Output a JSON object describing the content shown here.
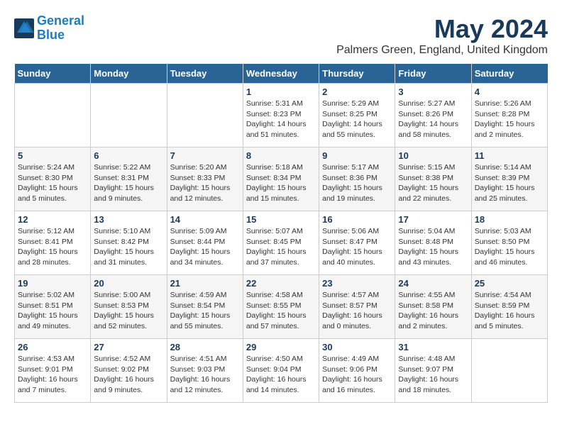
{
  "header": {
    "logo_line1": "General",
    "logo_line2": "Blue",
    "month": "May 2024",
    "location": "Palmers Green, England, United Kingdom"
  },
  "days_of_week": [
    "Sunday",
    "Monday",
    "Tuesday",
    "Wednesday",
    "Thursday",
    "Friday",
    "Saturday"
  ],
  "weeks": [
    [
      {
        "day": "",
        "info": ""
      },
      {
        "day": "",
        "info": ""
      },
      {
        "day": "",
        "info": ""
      },
      {
        "day": "1",
        "info": "Sunrise: 5:31 AM\nSunset: 8:23 PM\nDaylight: 14 hours\nand 51 minutes."
      },
      {
        "day": "2",
        "info": "Sunrise: 5:29 AM\nSunset: 8:25 PM\nDaylight: 14 hours\nand 55 minutes."
      },
      {
        "day": "3",
        "info": "Sunrise: 5:27 AM\nSunset: 8:26 PM\nDaylight: 14 hours\nand 58 minutes."
      },
      {
        "day": "4",
        "info": "Sunrise: 5:26 AM\nSunset: 8:28 PM\nDaylight: 15 hours\nand 2 minutes."
      }
    ],
    [
      {
        "day": "5",
        "info": "Sunrise: 5:24 AM\nSunset: 8:30 PM\nDaylight: 15 hours\nand 5 minutes."
      },
      {
        "day": "6",
        "info": "Sunrise: 5:22 AM\nSunset: 8:31 PM\nDaylight: 15 hours\nand 9 minutes."
      },
      {
        "day": "7",
        "info": "Sunrise: 5:20 AM\nSunset: 8:33 PM\nDaylight: 15 hours\nand 12 minutes."
      },
      {
        "day": "8",
        "info": "Sunrise: 5:18 AM\nSunset: 8:34 PM\nDaylight: 15 hours\nand 15 minutes."
      },
      {
        "day": "9",
        "info": "Sunrise: 5:17 AM\nSunset: 8:36 PM\nDaylight: 15 hours\nand 19 minutes."
      },
      {
        "day": "10",
        "info": "Sunrise: 5:15 AM\nSunset: 8:38 PM\nDaylight: 15 hours\nand 22 minutes."
      },
      {
        "day": "11",
        "info": "Sunrise: 5:14 AM\nSunset: 8:39 PM\nDaylight: 15 hours\nand 25 minutes."
      }
    ],
    [
      {
        "day": "12",
        "info": "Sunrise: 5:12 AM\nSunset: 8:41 PM\nDaylight: 15 hours\nand 28 minutes."
      },
      {
        "day": "13",
        "info": "Sunrise: 5:10 AM\nSunset: 8:42 PM\nDaylight: 15 hours\nand 31 minutes."
      },
      {
        "day": "14",
        "info": "Sunrise: 5:09 AM\nSunset: 8:44 PM\nDaylight: 15 hours\nand 34 minutes."
      },
      {
        "day": "15",
        "info": "Sunrise: 5:07 AM\nSunset: 8:45 PM\nDaylight: 15 hours\nand 37 minutes."
      },
      {
        "day": "16",
        "info": "Sunrise: 5:06 AM\nSunset: 8:47 PM\nDaylight: 15 hours\nand 40 minutes."
      },
      {
        "day": "17",
        "info": "Sunrise: 5:04 AM\nSunset: 8:48 PM\nDaylight: 15 hours\nand 43 minutes."
      },
      {
        "day": "18",
        "info": "Sunrise: 5:03 AM\nSunset: 8:50 PM\nDaylight: 15 hours\nand 46 minutes."
      }
    ],
    [
      {
        "day": "19",
        "info": "Sunrise: 5:02 AM\nSunset: 8:51 PM\nDaylight: 15 hours\nand 49 minutes."
      },
      {
        "day": "20",
        "info": "Sunrise: 5:00 AM\nSunset: 8:53 PM\nDaylight: 15 hours\nand 52 minutes."
      },
      {
        "day": "21",
        "info": "Sunrise: 4:59 AM\nSunset: 8:54 PM\nDaylight: 15 hours\nand 55 minutes."
      },
      {
        "day": "22",
        "info": "Sunrise: 4:58 AM\nSunset: 8:55 PM\nDaylight: 15 hours\nand 57 minutes."
      },
      {
        "day": "23",
        "info": "Sunrise: 4:57 AM\nSunset: 8:57 PM\nDaylight: 16 hours\nand 0 minutes."
      },
      {
        "day": "24",
        "info": "Sunrise: 4:55 AM\nSunset: 8:58 PM\nDaylight: 16 hours\nand 2 minutes."
      },
      {
        "day": "25",
        "info": "Sunrise: 4:54 AM\nSunset: 8:59 PM\nDaylight: 16 hours\nand 5 minutes."
      }
    ],
    [
      {
        "day": "26",
        "info": "Sunrise: 4:53 AM\nSunset: 9:01 PM\nDaylight: 16 hours\nand 7 minutes."
      },
      {
        "day": "27",
        "info": "Sunrise: 4:52 AM\nSunset: 9:02 PM\nDaylight: 16 hours\nand 9 minutes."
      },
      {
        "day": "28",
        "info": "Sunrise: 4:51 AM\nSunset: 9:03 PM\nDaylight: 16 hours\nand 12 minutes."
      },
      {
        "day": "29",
        "info": "Sunrise: 4:50 AM\nSunset: 9:04 PM\nDaylight: 16 hours\nand 14 minutes."
      },
      {
        "day": "30",
        "info": "Sunrise: 4:49 AM\nSunset: 9:06 PM\nDaylight: 16 hours\nand 16 minutes."
      },
      {
        "day": "31",
        "info": "Sunrise: 4:48 AM\nSunset: 9:07 PM\nDaylight: 16 hours\nand 18 minutes."
      },
      {
        "day": "",
        "info": ""
      }
    ]
  ]
}
